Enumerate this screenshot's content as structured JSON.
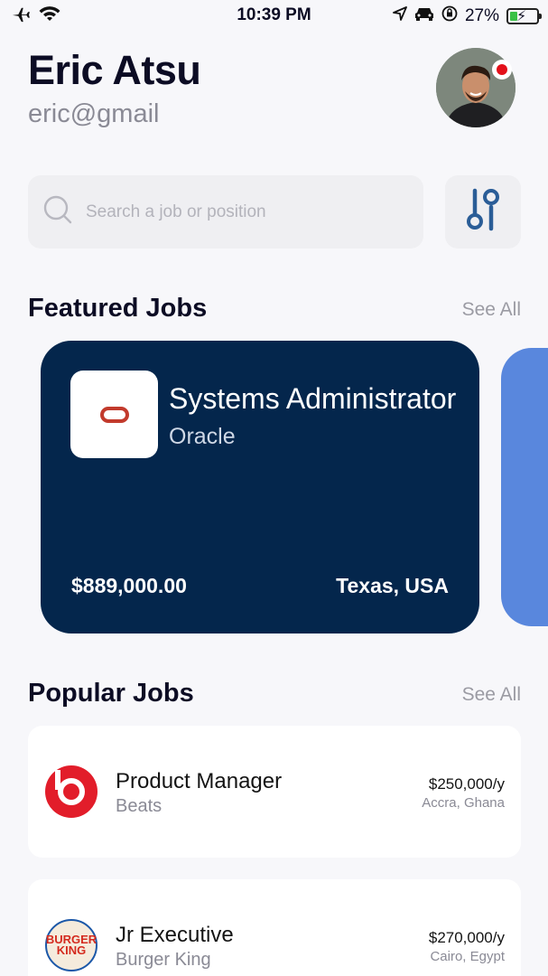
{
  "status_bar": {
    "time": "10:39 PM",
    "battery_percent": "27%",
    "battery_level": 0.27,
    "left_icons": [
      "airplane-icon",
      "wifi-icon"
    ],
    "right_icons": [
      "location-arrow-icon",
      "car-icon",
      "orientation-lock-icon",
      "battery-charging-icon"
    ]
  },
  "user": {
    "name": "Eric Atsu",
    "email": "eric@gmail",
    "has_notification": true
  },
  "search": {
    "placeholder": "Search a job or position",
    "icon": "search-icon",
    "filter_icon": "filter-sliders-icon"
  },
  "featured": {
    "title": "Featured Jobs",
    "see_all": "See All",
    "jobs": [
      {
        "title": "Systems Administrator",
        "company": "Oracle",
        "salary": "$889,000.00",
        "location": "Texas, USA",
        "color": "#04264c",
        "logo_icon": "oracle-logo-icon"
      }
    ],
    "next_card_color": "#5987dd"
  },
  "popular": {
    "title": "Popular Jobs",
    "see_all": "See All",
    "jobs": [
      {
        "title": "Product Manager",
        "company": "Beats",
        "salary": "$250,000/y",
        "location": "Accra, Ghana",
        "logo_icon": "beats-logo-icon"
      },
      {
        "title": "Jr Executive",
        "company": "Burger King",
        "salary": "$270,000/y",
        "location": "Cairo, Egypt",
        "logo_icon": "burger-king-logo-icon",
        "logo_text": "BURGER KING"
      }
    ]
  },
  "colors": {
    "background": "#f7f7fa",
    "accent_dark": "#04264c",
    "accent_blue": "#2a5d97",
    "notification": "#e3101a"
  }
}
